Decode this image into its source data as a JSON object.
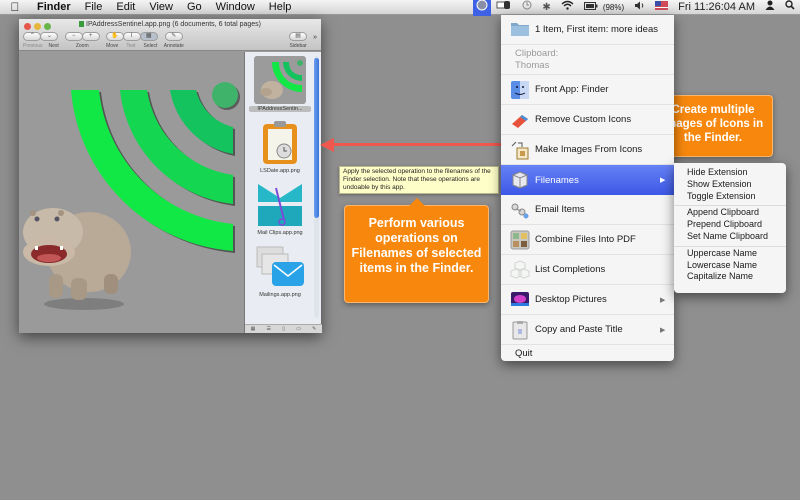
{
  "menubar": {
    "apple_icon": "apple-icon",
    "items": [
      "Finder",
      "File",
      "Edit",
      "View",
      "Go",
      "Window",
      "Help"
    ],
    "status": {
      "battery": "(98%)",
      "clock": "Fri 11:26:04 AM",
      "icons": [
        "app-menu-icon",
        "display-icon",
        "time-machine-icon",
        "bluetooth-icon",
        "wifi-icon",
        "battery-icon",
        "volume-icon",
        "flag-icon",
        "user-icon",
        "spotlight-icon"
      ]
    }
  },
  "window": {
    "title": "IPAddressSentinel.app.png (6 documents, 6 total pages)",
    "toolbar": {
      "previous": "Previous",
      "next": "Next",
      "zoom": "Zoom",
      "move": "Move",
      "text": "Text",
      "select": "Select",
      "annotate": "Annotate",
      "sidebar": "Sidebar"
    },
    "thumbnails": [
      {
        "caption": "IPAddressSentin...",
        "selected": true
      },
      {
        "caption": "LSDate.app.png",
        "selected": false
      },
      {
        "caption": "Mail Clips.app.png",
        "selected": false
      },
      {
        "caption": "Mailings.app.png",
        "selected": false
      }
    ]
  },
  "tooltip": "Apply the selected operation to the filenames of the Finder selection. Note that these operations are undoable by this app.",
  "callouts": {
    "filenames": "Perform various operations on Filenames of selected items in the Finder.",
    "make_images": "Create multiple images of Icons in the Finder."
  },
  "menu": {
    "items": [
      {
        "label": "1 Item, First item: more ideas",
        "icon": "folder-icon"
      },
      {
        "label": "Clipboard:",
        "sub": "Thomas"
      },
      {
        "label": "Front App: Finder",
        "icon": "finder-icon"
      },
      {
        "label": "Remove Custom Icons",
        "icon": "eraser-icon"
      },
      {
        "label": "Make Images From Icons",
        "icon": "images-icon"
      },
      {
        "label": "Filenames",
        "icon": "filenames-icon",
        "submenu": true,
        "highlighted": true
      },
      {
        "label": "Email Items",
        "icon": "email-icon"
      },
      {
        "label": "Combine Files Into PDF",
        "icon": "pdf-icon"
      },
      {
        "label": "List Completions",
        "icon": "list-icon"
      },
      {
        "label": "Desktop Pictures",
        "icon": "desktop-icon",
        "submenu": true
      },
      {
        "label": "Copy and Paste Title",
        "icon": "clipboard-icon",
        "submenu": true
      },
      {
        "label": "Quit"
      }
    ],
    "submenu_arrow": "▶"
  },
  "submenu": {
    "groups": [
      [
        "Hide Extension",
        "Show Extension",
        "Toggle Extension"
      ],
      [
        "Append Clipboard",
        "Prepend Clipboard",
        "Set Name Clipboard"
      ],
      [
        "Uppercase Name",
        "Lowercase Name",
        "Capitalize Name"
      ]
    ]
  },
  "colors": {
    "highlight": "#3c58e6",
    "callout": "#f7880d",
    "arrow": "#f0584f",
    "signal_green": "#1ee04a"
  }
}
